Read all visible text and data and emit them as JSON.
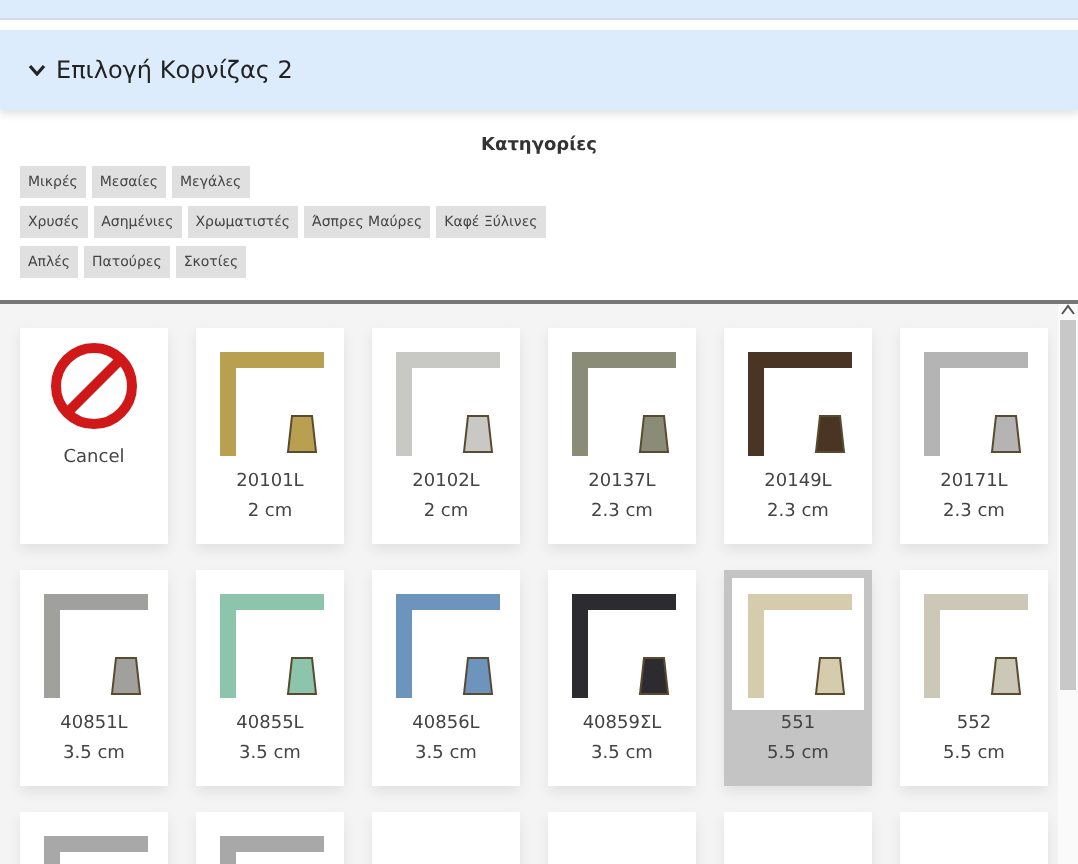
{
  "accordion": {
    "title": "Επιλογή Κορνίζας 2",
    "expanded": true
  },
  "categories": {
    "title": "Κατηγορίες",
    "rows": [
      [
        "Μικρές",
        "Μεσαίες",
        "Μεγάλες"
      ],
      [
        "Χρυσές",
        "Ασημένιες",
        "Χρωματιστές",
        "Άσπρες Μαύρες",
        "Καφέ Ξύλινες"
      ],
      [
        "Απλές",
        "Πατούρες",
        "Σκοτίες"
      ]
    ]
  },
  "frames": [
    {
      "kind": "cancel",
      "code": "Cancel",
      "selected": false
    },
    {
      "kind": "frame",
      "code": "20101L",
      "size": "2 cm",
      "color": "#b8a050",
      "selected": false
    },
    {
      "kind": "frame",
      "code": "20102L",
      "size": "2 cm",
      "color": "#c8c8c4",
      "selected": false
    },
    {
      "kind": "frame",
      "code": "20137L",
      "size": "2.3 cm",
      "color": "#8a8c78",
      "selected": false
    },
    {
      "kind": "frame",
      "code": "20149L",
      "size": "2.3 cm",
      "color": "#4a3424",
      "selected": false
    },
    {
      "kind": "frame",
      "code": "20171L",
      "size": "2.3 cm",
      "color": "#b4b4b4",
      "selected": false
    },
    {
      "kind": "frame",
      "code": "40851L",
      "size": "3.5 cm",
      "color": "#a0a09c",
      "selected": false
    },
    {
      "kind": "frame",
      "code": "40855L",
      "size": "3.5 cm",
      "color": "#8cc4ac",
      "selected": false
    },
    {
      "kind": "frame",
      "code": "40856L",
      "size": "3.5 cm",
      "color": "#6c94bc",
      "selected": false
    },
    {
      "kind": "frame",
      "code": "40859ΣL",
      "size": "3.5 cm",
      "color": "#2c2c30",
      "selected": false
    },
    {
      "kind": "frame",
      "code": "551",
      "size": "5.5 cm",
      "color": "#d4ccac",
      "selected": true
    },
    {
      "kind": "frame",
      "code": "552",
      "size": "5.5 cm",
      "color": "#ccc8b8",
      "selected": false
    },
    {
      "kind": "frame",
      "color": "#a8a8a8",
      "selected": false
    },
    {
      "kind": "frame",
      "color": "#a8a8a8",
      "selected": false
    },
    {
      "kind": "frame",
      "selected": false
    },
    {
      "kind": "frame",
      "selected": false
    },
    {
      "kind": "frame",
      "selected": false
    },
    {
      "kind": "frame",
      "selected": false
    }
  ]
}
